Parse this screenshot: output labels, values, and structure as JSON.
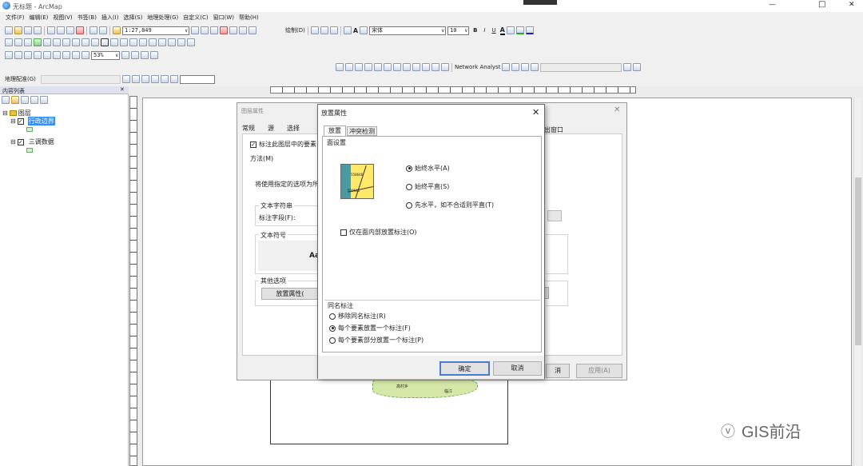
{
  "window": {
    "title": "无标题 - ArcMap",
    "min": "—",
    "max": "□",
    "close": "✕"
  },
  "menu": [
    "文件(F)",
    "编辑(E)",
    "视图(V)",
    "书签(B)",
    "插入(I)",
    "选择(S)",
    "地理处理(G)",
    "自定义(C)",
    "窗口(W)",
    "帮助(H)"
  ],
  "toolbar": {
    "scale": "1:27,849",
    "font": "宋体",
    "size": "10",
    "zoom": "53%",
    "draw": "绘制(D)",
    "bold": "B",
    "italic": "I",
    "underline": "U",
    "georef": "地理配准(G)",
    "network": "Network Analyst"
  },
  "toc": {
    "title": "内容列表",
    "pin": "✕",
    "root": "图层",
    "layers": [
      {
        "name": "行政边界",
        "checked": true,
        "selected": true
      },
      {
        "name": "三调数据",
        "checked": true,
        "selected": false
      }
    ]
  },
  "layer_props": {
    "title": "图层属性",
    "tabs": [
      "常规",
      "源",
      "选择"
    ],
    "tab_right": "出窗口",
    "label_check": "标注此图层中的要素",
    "method": "方法(M)",
    "desc": "将使用指定的选项为所",
    "text_str": "文本字符串",
    "label_field": "标注字段(F):",
    "text_sym": "文本符号",
    "sample": "Aa",
    "other": "其他选项",
    "placement_btn": "放置属性(",
    "apply": "应用(A)",
    "cancel_partial": "消"
  },
  "placement": {
    "title": "放置属性",
    "tabs": [
      "放置",
      "冲突检测"
    ],
    "poly_group": "面设置",
    "opt_horizontal": "始终水平(A)",
    "opt_straight": "始终平直(S)",
    "opt_firsthoriz": "先水平，如不合适则平直(T)",
    "inside_only": "仅在面内部放置标注(O)",
    "dup_group": "同名标注",
    "dup_remove": "移除同名标注(R)",
    "dup_one": "每个要素放置一个标注(F)",
    "dup_part": "每个要素部分放置一个标注(P)",
    "ok": "确定",
    "cancel": "取消",
    "preview_labels": [
      "558646",
      "559645"
    ]
  },
  "map": {
    "labels": [
      "高村乡",
      "临江"
    ]
  },
  "watermark": "GIS前沿"
}
